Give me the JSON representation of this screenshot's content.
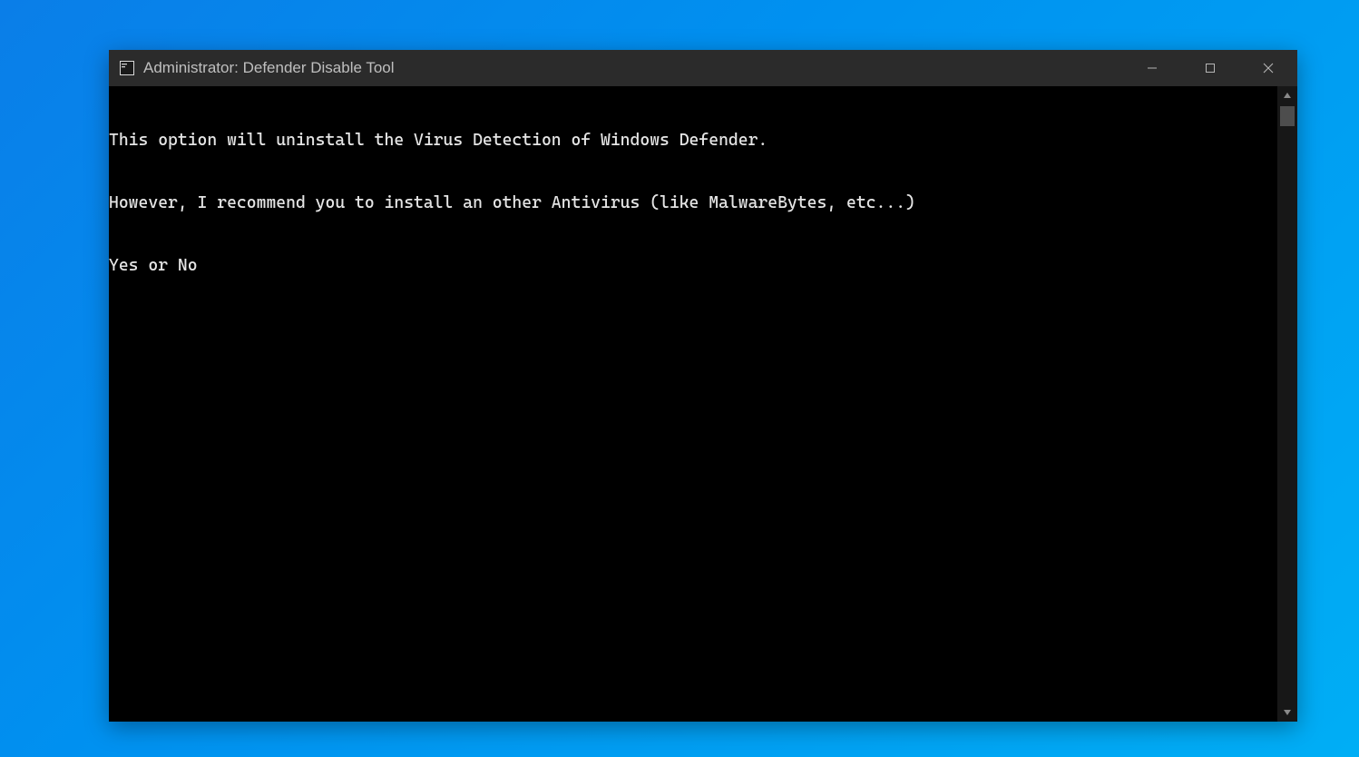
{
  "window": {
    "title": "Administrator:  Defender Disable Tool",
    "icon": "cmd-icon"
  },
  "console": {
    "lines": [
      "This option will uninstall the Virus Detection of Windows Defender.",
      "However, I recommend you to install an other Antivirus (like MalwareBytes, etc...)",
      "Yes or No"
    ]
  },
  "controls": {
    "minimize": "minimize",
    "maximize": "maximize",
    "close": "close"
  },
  "colors": {
    "desktop_start": "#0a7ee8",
    "desktop_end": "#00aef5",
    "titlebar_bg": "#2b2b2b",
    "console_bg": "#000000",
    "console_fg": "#e5e5e5"
  }
}
